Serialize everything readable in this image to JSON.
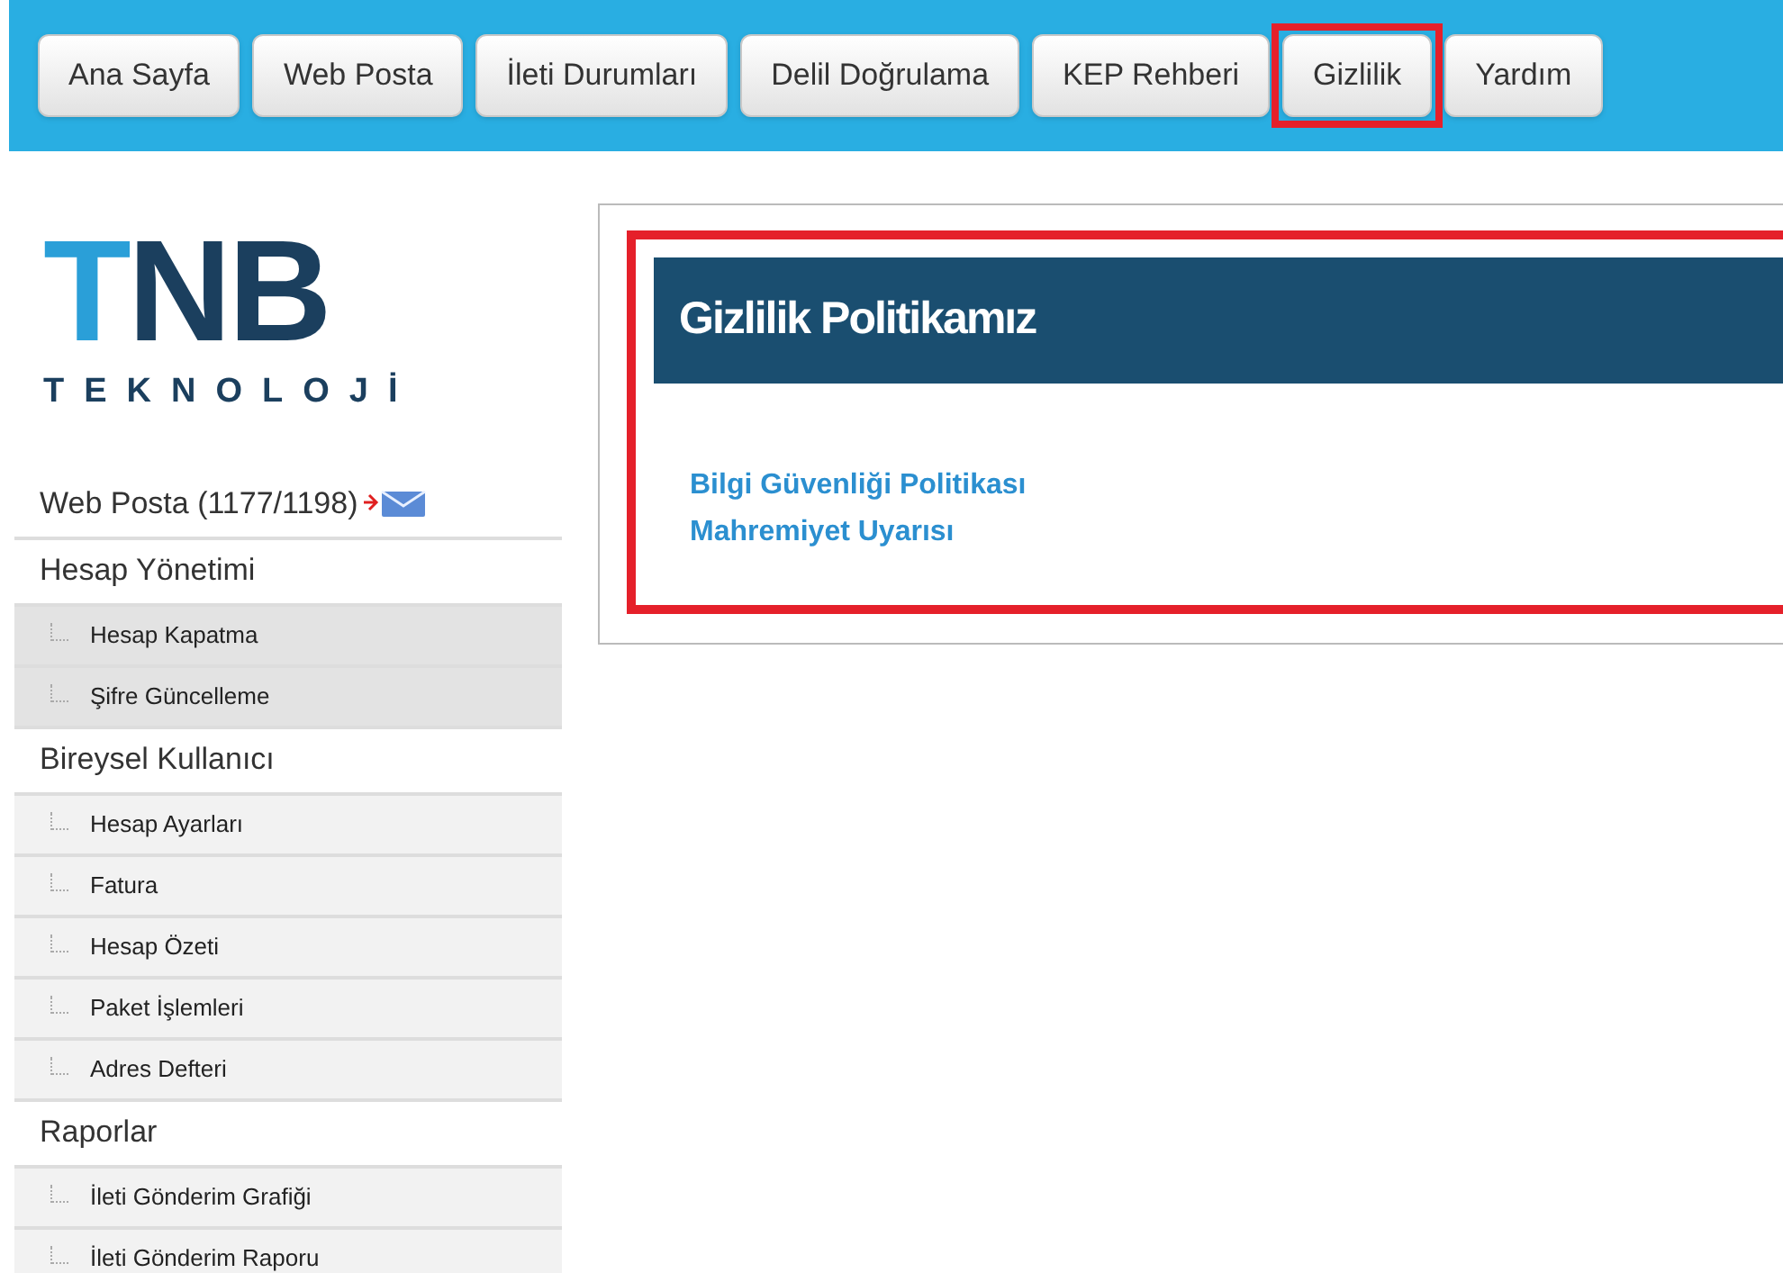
{
  "nav": [
    {
      "label": "Ana Sayfa",
      "highlighted": false
    },
    {
      "label": "Web Posta",
      "highlighted": false
    },
    {
      "label": "İleti Durumları",
      "highlighted": false
    },
    {
      "label": "Delil Doğrulama",
      "highlighted": false
    },
    {
      "label": "KEP Rehberi",
      "highlighted": false
    },
    {
      "label": "Gizlilik",
      "highlighted": true
    },
    {
      "label": "Yardım",
      "highlighted": false
    }
  ],
  "logo": {
    "letters": [
      {
        "text": "T",
        "color": "#2a9fd8"
      },
      {
        "text": "N",
        "color": "#1b3f5e"
      },
      {
        "text": "B",
        "color": "#1b3f5e"
      }
    ],
    "subtitle": "TEKNOLOJİ"
  },
  "sidebar": {
    "items": [
      {
        "kind": "mail",
        "label": "Web Posta (1177/1198)"
      },
      {
        "kind": "section",
        "label": "Hesap Yönetimi",
        "children": [
          {
            "label": "Hesap Kapatma",
            "selected": true
          },
          {
            "label": "Şifre Güncelleme",
            "selected": true
          }
        ]
      },
      {
        "kind": "section",
        "label": "Bireysel Kullanıcı",
        "children": [
          {
            "label": "Hesap Ayarları",
            "selected": false
          },
          {
            "label": "Fatura",
            "selected": false
          },
          {
            "label": "Hesap Özeti",
            "selected": false
          },
          {
            "label": "Paket İşlemleri",
            "selected": false
          },
          {
            "label": "Adres Defteri",
            "selected": false
          }
        ]
      },
      {
        "kind": "section",
        "label": "Raporlar",
        "children": [
          {
            "label": "İleti Gönderim Grafiği",
            "selected": false
          },
          {
            "label": "İleti Gönderim Raporu",
            "selected": false
          }
        ]
      }
    ]
  },
  "content": {
    "title": "Gizlilik Politikamız",
    "highlighted": true,
    "links": [
      "Bilgi Güvenliği Politikası",
      "Mahremiyet Uyarısı"
    ]
  }
}
